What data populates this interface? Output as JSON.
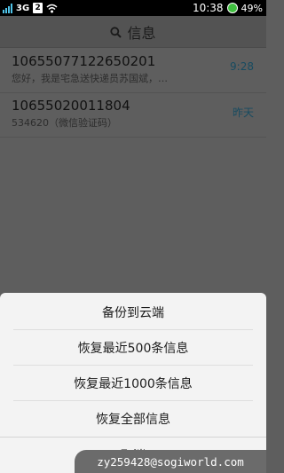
{
  "status_bar": {
    "network": "3G",
    "sim": "2",
    "time": "10:38",
    "battery": "49%"
  },
  "header": {
    "title": "信息"
  },
  "messages": [
    {
      "sender": "10655077122650201",
      "preview": "您好，我是宅急送快递员苏国斌，…",
      "time": "9:28"
    },
    {
      "sender": "10655020011804",
      "preview": "534620（微信验证码）",
      "time": "昨天"
    }
  ],
  "action_sheet": {
    "backup_cloud": "备份到云端",
    "restore_500": "恢复最近500条信息",
    "restore_1000": "恢复最近1000条信息",
    "restore_all": "恢复全部信息",
    "cancel": "取消"
  },
  "watermark": "zy259428@sogiworld.com",
  "colors": {
    "overlay_bg": "#5e5e5e",
    "sheet_bg": "#f3f3f3",
    "time_text": "#184b60",
    "battery_green": "#3fbf3f"
  }
}
